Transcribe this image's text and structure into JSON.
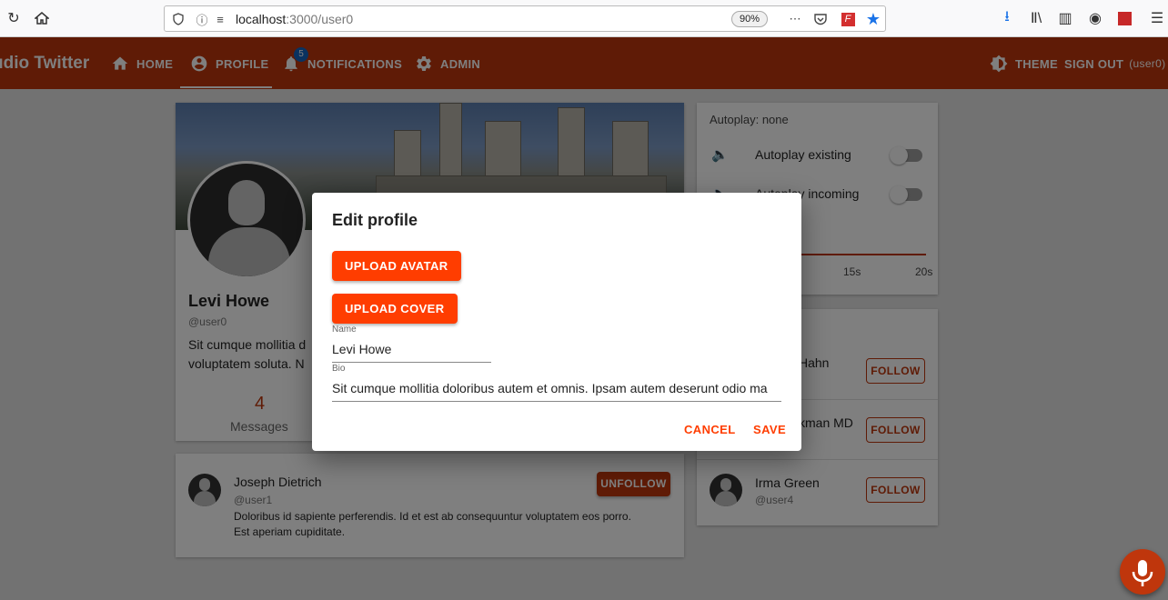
{
  "browser": {
    "url_host": "localhost",
    "url_port_path": ":3000/user0",
    "zoom": "90%"
  },
  "appbar": {
    "title": "udio Twitter",
    "nav": [
      "HOME",
      "PROFILE",
      "NOTIFICATIONS",
      "ADMIN"
    ],
    "notifications_count": "5",
    "theme_label": "THEME",
    "signout_label": "SIGN OUT",
    "signout_user": "(user0)"
  },
  "profile": {
    "name": "Levi Howe",
    "handle": "@user0",
    "bio_line1": "Sit cumque mollitia d",
    "bio_line2": "voluptatem soluta. N",
    "messages_count": "4",
    "messages_label": "Messages"
  },
  "tweet": {
    "author": "Joseph Dietrich",
    "handle": "@user1",
    "text": "Doloribus id sapiente perferendis. Id et est ab consequuntur voluptatem eos porro. Est aperiam cupiditate.",
    "button": "UNFOLLOW"
  },
  "settings": {
    "autoplay": "Autoplay: none",
    "autoplay_existing": "Autoplay existing",
    "autoplay_incoming": "Autoplay incoming",
    "seconds_partial": "onds",
    "tick_15": "15s",
    "tick_20": "20s"
  },
  "follow_list": [
    {
      "name": "Hahn",
      "handle": "",
      "button": "FOLLOW"
    },
    {
      "name": "kman MD",
      "handle": "",
      "button": "FOLLOW"
    },
    {
      "name": "Irma Green",
      "handle": "@user4",
      "button": "FOLLOW"
    }
  ],
  "dialog": {
    "title": "Edit profile",
    "upload_avatar": "UPLOAD AVATAR",
    "upload_cover": "UPLOAD COVER",
    "name_label": "Name",
    "name_value": "Levi Howe",
    "bio_label": "Bio",
    "bio_value": "Sit cumque mollitia doloribus autem et omnis. Ipsam autem deserunt odio ma",
    "cancel": "CANCEL",
    "save": "SAVE"
  },
  "colors": {
    "primary": "#bf360c",
    "accent": "#ff3d00",
    "badge": "#1565c0"
  }
}
